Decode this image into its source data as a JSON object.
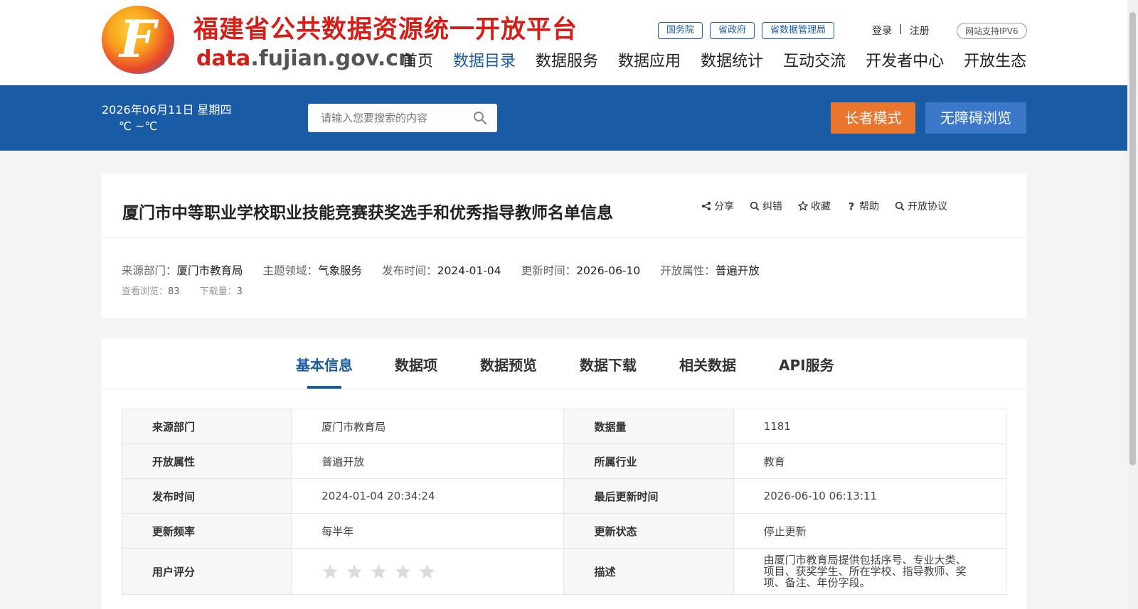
{
  "header": {
    "site_title": "福建省公共数据资源统一开放平台",
    "domain_part1": "data",
    "domain_part2": ".fujian.gov.cn",
    "gov_links": [
      "国务院",
      "省政府",
      "省数据管理局"
    ],
    "login": "登录",
    "separator": "|",
    "register": "注册",
    "ipv6": "网站支持IPV6",
    "nav": [
      "首页",
      "数据目录",
      "数据服务",
      "数据应用",
      "数据统计",
      "互动交流",
      "开发者中心",
      "开放生态"
    ],
    "active_nav": "数据目录"
  },
  "bar": {
    "date": "2026年06月11日  星期四",
    "temp": "℃ ~℃",
    "search_placeholder": "请输入您要搜索的内容",
    "elder_mode": "长者模式",
    "accessibility": "无障碍浏览"
  },
  "dataset": {
    "title": "厦门市中等职业学校职业技能竞赛获奖选手和优秀指导教师名单信息",
    "actions": [
      "分享",
      "纠错",
      "收藏",
      "帮助",
      "开放协议"
    ],
    "meta": [
      {
        "label": "来源部门：",
        "value": "厦门市教育局"
      },
      {
        "label": "主题领域：",
        "value": "气象服务"
      },
      {
        "label": "发布时间：",
        "value": "2024-01-04"
      },
      {
        "label": "更新时间：",
        "value": "2026-06-10"
      },
      {
        "label": "开放属性：",
        "value": "普遍开放"
      }
    ],
    "views_label": "查看浏览：",
    "views": "83",
    "downloads_label": "下载量：",
    "downloads": "3"
  },
  "tabs": [
    "基本信息",
    "数据项",
    "数据预览",
    "数据下载",
    "相关数据",
    "API服务"
  ],
  "info": {
    "rows": [
      {
        "k1": "来源部门",
        "v1": "厦门市教育局",
        "k2": "数据量",
        "v2": "1181"
      },
      {
        "k1": "开放属性",
        "v1": "普遍开放",
        "k2": "所属行业",
        "v2": "教育"
      },
      {
        "k1": "发布时间",
        "v1": "2024-01-04 20:34:24",
        "k2": "最后更新时间",
        "v2": "2026-06-10 06:13:11"
      },
      {
        "k1": "更新频率",
        "v1": "每半年",
        "k2": "更新状态",
        "v2": "停止更新"
      }
    ],
    "rating_label": "用户评分",
    "rating": 0,
    "desc_label": "描述",
    "desc": "由厦门市教育局提供包括序号、专业大类、项目、获奖学生、所在学校、指导教师、奖项、备注、年份字段。"
  },
  "colors": {
    "primary": "#1a5ba5",
    "elder": "#e9762c",
    "access": "#3b78c9",
    "title_red": "#d31f18"
  }
}
